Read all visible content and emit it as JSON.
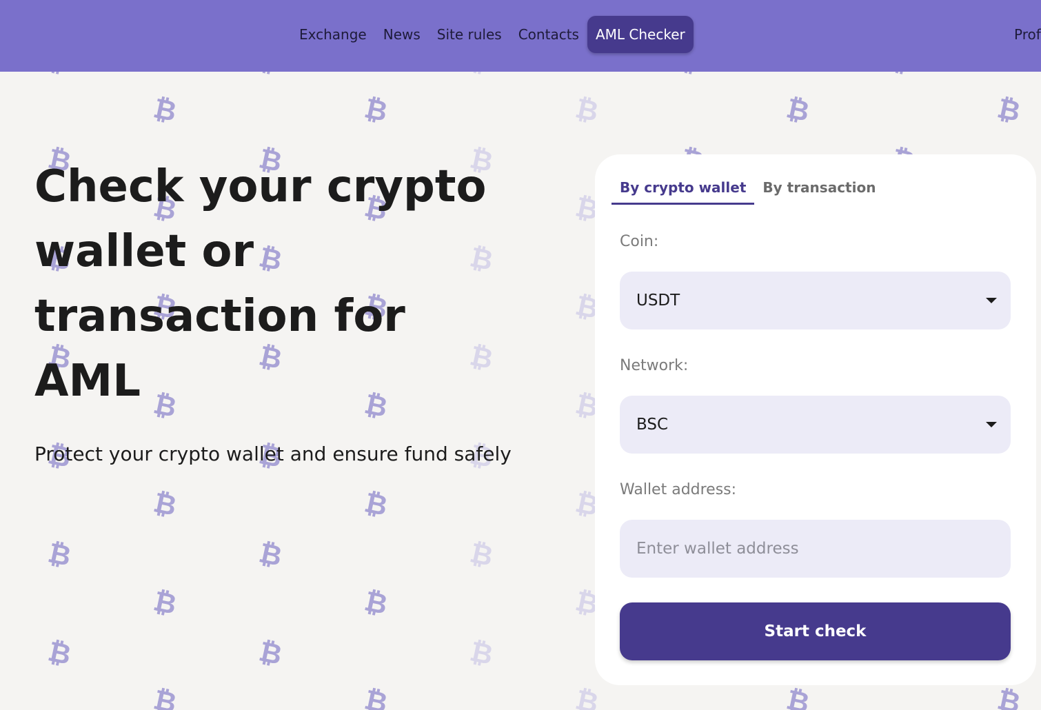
{
  "nav": {
    "items": [
      {
        "label": "Exchange",
        "active": false
      },
      {
        "label": "News",
        "active": false
      },
      {
        "label": "Site rules",
        "active": false
      },
      {
        "label": "Contacts",
        "active": false
      },
      {
        "label": "AML Checker",
        "active": true
      }
    ],
    "profile_label": "Prof"
  },
  "hero": {
    "title_lines": [
      "Check your crypto",
      "wallet or",
      "transaction for",
      "AML"
    ],
    "subtitle": "Protect your crypto wallet and ensure fund safely"
  },
  "form": {
    "tabs": [
      {
        "label": "By crypto wallet",
        "active": true
      },
      {
        "label": "By transaction",
        "active": false
      }
    ],
    "coin_label": "Coin:",
    "coin_value": "USDT",
    "network_label": "Network:",
    "network_value": "BSC",
    "wallet_label": "Wallet address:",
    "wallet_placeholder": "Enter wallet address",
    "wallet_value": "",
    "submit_label": "Start check"
  },
  "background": {
    "icon": "bitcoin-icon",
    "glyph": "₿"
  },
  "colors": {
    "header": "#7a70cb",
    "accent": "#463a8d",
    "page_bg": "#f5f4f2",
    "field_bg": "#ecebf7",
    "pattern": "#a9a3d6"
  }
}
